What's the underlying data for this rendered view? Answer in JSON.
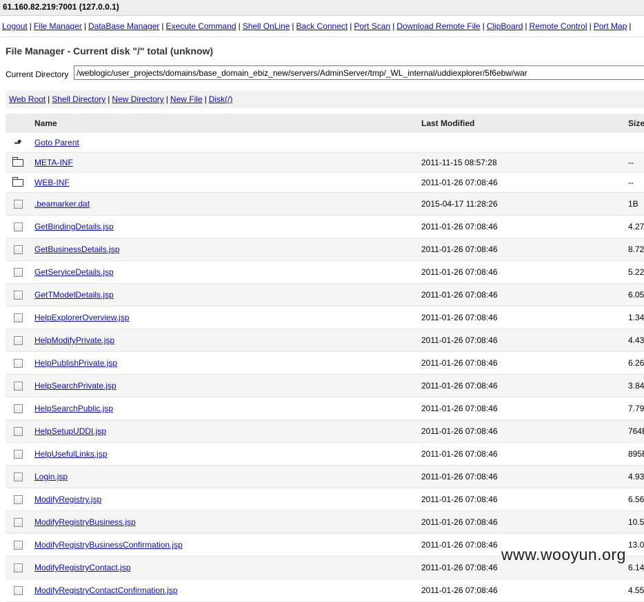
{
  "host": "61.160.82.219:7001 (127.0.0.1)",
  "nav": [
    "Logout",
    "File Manager",
    "DataBase Manager",
    "Execute Command",
    "Shell OnLine",
    "Back Connect",
    "Port Scan",
    "Download Remote File",
    "ClipBoard",
    "Remote Control",
    "Port Map"
  ],
  "title": "File Manager - Current disk \"/\" total (unknow)",
  "current_dir_label": "Current Directory",
  "current_dir": "/weblogic/user_projects/domains/base_domain_ebiz_new/servers/AdminServer/tmp/_WL_internal/uddiexplorer/5f6ebw/war",
  "quick_links": [
    "Web Root",
    "Shell Directory",
    "New Directory",
    "New File",
    "Disk(/)"
  ],
  "columns": {
    "name": "Name",
    "modified": "Last Modified",
    "size": "Size"
  },
  "parent_label": "Goto Parent",
  "dirs": [
    {
      "name": "META-INF",
      "modified": "2011-11-15 08:57:28",
      "size": "--"
    },
    {
      "name": "WEB-INF",
      "modified": "2011-01-26 07:08:46",
      "size": "--"
    }
  ],
  "files": [
    {
      "name": ".beamarker.dat",
      "modified": "2015-04-17 11:28:26",
      "size": "1B"
    },
    {
      "name": "GetBindingDetails.jsp",
      "modified": "2011-01-26 07:08:46",
      "size": "4.27"
    },
    {
      "name": "GetBusinessDetails.jsp",
      "modified": "2011-01-26 07:08:46",
      "size": "8.72"
    },
    {
      "name": "GetServiceDetails.jsp",
      "modified": "2011-01-26 07:08:46",
      "size": "5.22"
    },
    {
      "name": "GetTModelDetails.jsp",
      "modified": "2011-01-26 07:08:46",
      "size": "6.05"
    },
    {
      "name": "HelpExplorerOverview.jsp",
      "modified": "2011-01-26 07:08:46",
      "size": "1.34"
    },
    {
      "name": "HelpModifyPrivate.jsp",
      "modified": "2011-01-26 07:08:46",
      "size": "4.43"
    },
    {
      "name": "HelpPublishPrivate.jsp",
      "modified": "2011-01-26 07:08:46",
      "size": "6.26"
    },
    {
      "name": "HelpSearchPrivate.jsp",
      "modified": "2011-01-26 07:08:46",
      "size": "3.84"
    },
    {
      "name": "HelpSearchPublic.jsp",
      "modified": "2011-01-26 07:08:46",
      "size": "7.79"
    },
    {
      "name": "HelpSetupUDDI.jsp",
      "modified": "2011-01-26 07:08:46",
      "size": "764B"
    },
    {
      "name": "HelpUsefulLinks.jsp",
      "modified": "2011-01-26 07:08:46",
      "size": "895B"
    },
    {
      "name": "Login.jsp",
      "modified": "2011-01-26 07:08:46",
      "size": "4.93"
    },
    {
      "name": "ModifyRegistry.jsp",
      "modified": "2011-01-26 07:08:46",
      "size": "6.56"
    },
    {
      "name": "ModifyRegistryBusiness.jsp",
      "modified": "2011-01-26 07:08:46",
      "size": "10.5"
    },
    {
      "name": "ModifyRegistryBusinessConfirmation.jsp",
      "modified": "2011-01-26 07:08:46",
      "size": "13.0"
    },
    {
      "name": "ModifyRegistryContact.jsp",
      "modified": "2011-01-26 07:08:46",
      "size": "6.14"
    },
    {
      "name": "ModifyRegistryContactConfirmation.jsp",
      "modified": "2011-01-26 07:08:46",
      "size": "4.55"
    }
  ],
  "watermark": "www.wooyun.org"
}
